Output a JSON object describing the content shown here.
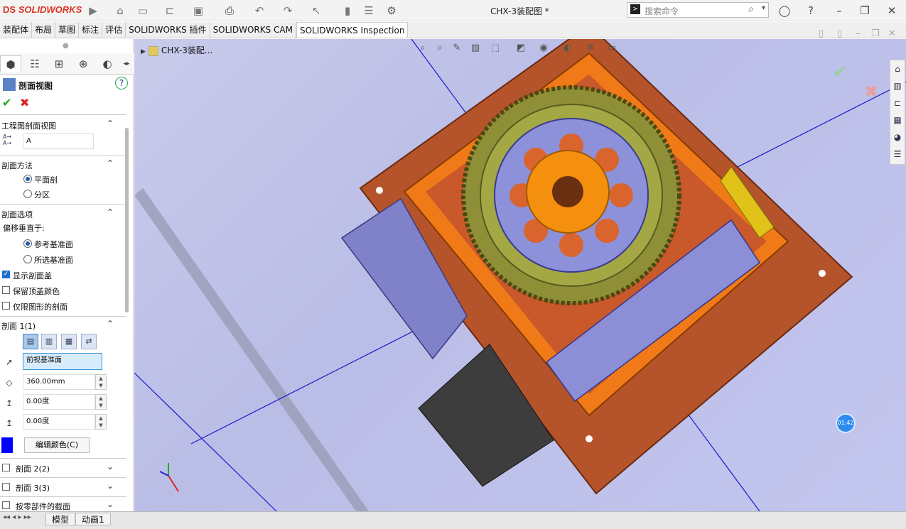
{
  "app": {
    "logo_ds": "DS",
    "logo_text": "SOLIDWORKS",
    "title": "CHX-3装配图 *",
    "search_placeholder": "搜索命令"
  },
  "tabs": [
    "装配体",
    "布局",
    "草图",
    "标注",
    "评估",
    "SOLIDWORKS 插件",
    "SOLIDWORKS CAM",
    "SOLIDWORKS Inspection"
  ],
  "active_tab": "SOLIDWORKS Inspection",
  "panel": {
    "title": "剖面视图",
    "sections": {
      "drawing_section": "工程图剖面视图",
      "method": "剖面方法",
      "options": "剖面选项",
      "section1": "剖面 1(1)",
      "section2": "剖面 2(2)",
      "section3": "剖面 3(3)",
      "by_part": "按零部件的截面"
    },
    "label_value": "A",
    "method_options": [
      "平面剖",
      "分区"
    ],
    "offset_label": "偏移垂直于:",
    "offset_options": [
      "参考基准面",
      "所选基准面"
    ],
    "checkboxes": [
      {
        "label": "显示剖面盖",
        "checked": true
      },
      {
        "label": "保留顶盖颜色",
        "checked": false
      },
      {
        "label": "仅限图形的剖面",
        "checked": false
      }
    ],
    "plane_value": "前视基准面",
    "distance_value": "360.00mm",
    "angle_x_value": "0.00度",
    "angle_y_value": "0.00度",
    "color_button": "编辑颜色(C)",
    "color": "#0000ff"
  },
  "tree": {
    "root": "CHX-3装配..."
  },
  "timer": "01:42",
  "bottom_tabs": [
    "模型",
    "动画1"
  ]
}
